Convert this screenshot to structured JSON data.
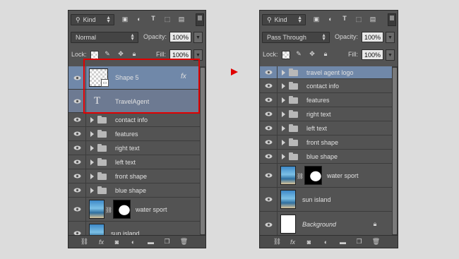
{
  "left_panel": {
    "kind_label": "Kind",
    "blend_mode": "Normal",
    "opacity_label": "Opacity:",
    "opacity_value": "100%",
    "lock_label": "Lock:",
    "fill_label": "Fill:",
    "fill_value": "100%",
    "layers": [
      {
        "name": "Shape 5",
        "fx": "fx"
      },
      {
        "name": "TravelAgent",
        "type_glyph": "T"
      },
      {
        "name": "contact info"
      },
      {
        "name": "features"
      },
      {
        "name": "right text"
      },
      {
        "name": "left text"
      },
      {
        "name": "front shape"
      },
      {
        "name": "blue shape"
      },
      {
        "name": "water sport"
      },
      {
        "name": "sun island"
      }
    ]
  },
  "right_panel": {
    "kind_label": "Kind",
    "blend_mode": "Pass Through",
    "opacity_label": "Opacity:",
    "opacity_value": "100%",
    "lock_label": "Lock:",
    "fill_label": "Fill:",
    "fill_value": "100%",
    "layers": [
      {
        "name": "travel agent logo"
      },
      {
        "name": "contact info"
      },
      {
        "name": "features"
      },
      {
        "name": "right text"
      },
      {
        "name": "left text"
      },
      {
        "name": "front shape"
      },
      {
        "name": "blue shape"
      },
      {
        "name": "water sport"
      },
      {
        "name": "sun island"
      },
      {
        "name": "Background"
      }
    ]
  },
  "colors": {
    "highlight": "#e00000",
    "panel_bg": "#535353",
    "selected_layer": "#7088a9"
  },
  "icons": {
    "visibility": "eye-icon",
    "group": "folder-icon",
    "lock": "lock-icon",
    "link": "link-icon",
    "fx": "fx-icon",
    "mask": "mask-icon",
    "adjustment": "adjustment-icon",
    "new_group": "new-group-icon",
    "new_layer": "new-layer-icon",
    "delete": "trash-icon"
  }
}
